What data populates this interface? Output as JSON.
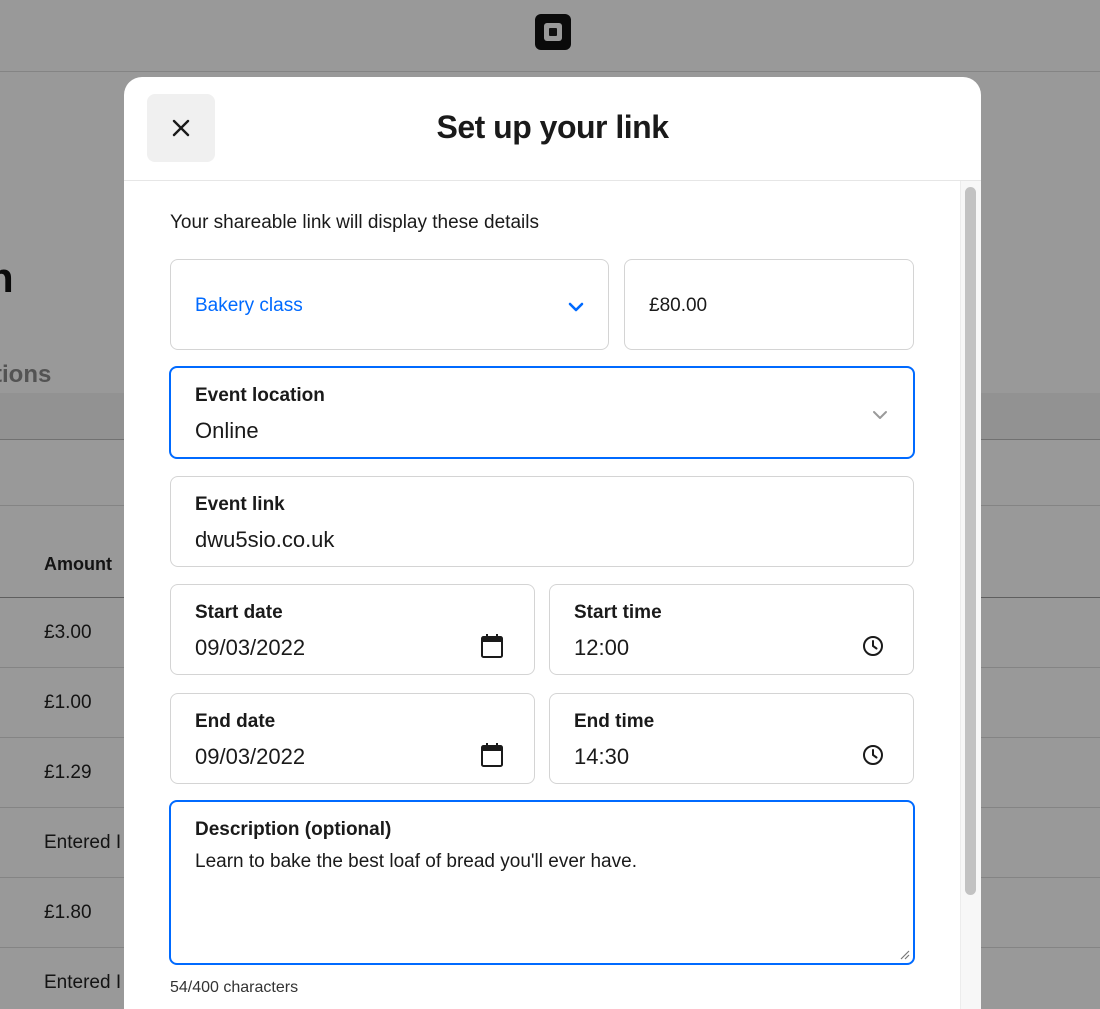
{
  "background": {
    "heading_partial": "n",
    "tab_partial": "tions",
    "column_header": "Amount",
    "rows": [
      "£3.00",
      "£1.00",
      "£1.29",
      "Entered I",
      "£1.80",
      "Entered I"
    ]
  },
  "modal": {
    "title": "Set up your link",
    "close_icon": "close-icon",
    "intro": "Your shareable link will display these details",
    "item_select": {
      "value": "Bakery class",
      "icon": "chevron-down-icon"
    },
    "price": {
      "value": "£80.00"
    },
    "event_location": {
      "label": "Event location",
      "value": "Online",
      "icon": "chevron-down-icon"
    },
    "event_link": {
      "label": "Event link",
      "value": "dwu5sio.co.uk"
    },
    "start_date": {
      "label": "Start date",
      "value": "09/03/2022",
      "icon": "calendar-icon"
    },
    "start_time": {
      "label": "Start time",
      "value": "12:00",
      "icon": "clock-icon"
    },
    "end_date": {
      "label": "End date",
      "value": "09/03/2022",
      "icon": "calendar-icon"
    },
    "end_time": {
      "label": "End time",
      "value": "14:30",
      "icon": "clock-icon"
    },
    "description": {
      "label": "Description (optional)",
      "value": "Learn to bake the best loaf of bread you'll ever have."
    },
    "char_count": "54/400 characters"
  },
  "colors": {
    "accent": "#006aff",
    "overlay": "rgba(0,0,0,0.40)"
  }
}
